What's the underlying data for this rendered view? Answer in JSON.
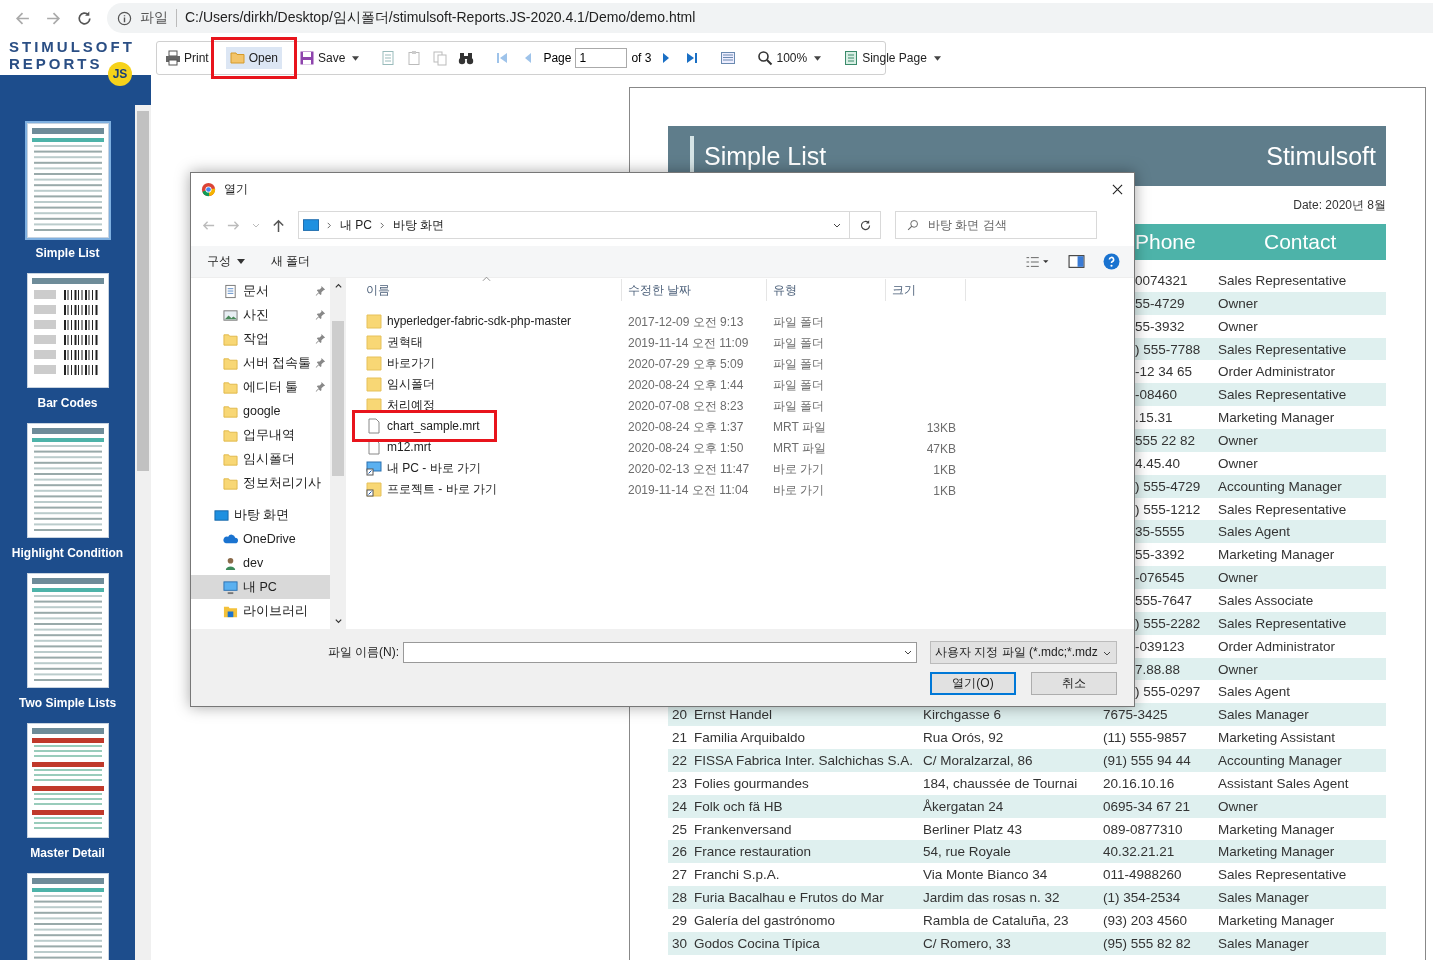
{
  "browser": {
    "scheme_label": "파일",
    "url": "C:/Users/dirkh/Desktop/임시폴더/stimulsoft-Reports.JS-2020.4.1/Demo/demo.html"
  },
  "logo": {
    "line1": "STIMULSOFT",
    "line2": "REPORTS",
    "badge": "JS"
  },
  "sidebar": {
    "items": [
      {
        "label": "Simple List",
        "kind": "list",
        "selected": true
      },
      {
        "label": "Bar Codes",
        "kind": "barcode",
        "selected": false
      },
      {
        "label": "Highlight Condition",
        "kind": "list",
        "selected": false
      },
      {
        "label": "Two Simple Lists",
        "kind": "list",
        "selected": false
      },
      {
        "label": "Master Detail",
        "kind": "master",
        "selected": false
      },
      {
        "kind": "list",
        "selected": false
      }
    ]
  },
  "toolbar": {
    "print": {
      "label": "Print"
    },
    "open": {
      "label": "Open",
      "highlighted": true,
      "annotated": true
    },
    "save": {
      "label": "Save"
    },
    "page_label": "Page",
    "page_input": "1",
    "page_count": "of 3",
    "zoom": "100%",
    "view_mode": "Single Page"
  },
  "report": {
    "title": "Simple List",
    "company": "Stimulsoft",
    "date": "Date: 2020년 8월",
    "columns": [
      "Phone",
      "Contact"
    ],
    "rows": [
      {
        "phone": "0074321",
        "contact": "Sales Representative"
      },
      {
        "phone": "55-4729",
        "contact": "Owner"
      },
      {
        "phone": "55-3932",
        "contact": "Owner"
      },
      {
        "phone": ") 555-7788",
        "contact": "Sales Representative"
      },
      {
        "phone": "-12 34 65",
        "contact": "Order Administrator"
      },
      {
        "phone": "-08460",
        "contact": "Sales Representative"
      },
      {
        "phone": ".15.31",
        "contact": "Marketing Manager"
      },
      {
        "phone": "555 22 82",
        "contact": "Owner"
      },
      {
        "phone": "4.45.40",
        "contact": "Owner"
      },
      {
        "phone": ") 555-4729",
        "contact": "Accounting Manager"
      },
      {
        "phone": ") 555-1212",
        "contact": "Sales Representative"
      },
      {
        "phone": "35-5555",
        "contact": "Sales Agent"
      },
      {
        "phone": "55-3392",
        "contact": "Marketing Manager"
      },
      {
        "phone": "-076545",
        "contact": "Owner"
      },
      {
        "phone": "555-7647",
        "contact": "Sales Associate"
      },
      {
        "phone": ") 555-2282",
        "contact": "Sales Representative"
      },
      {
        "phone": "-039123",
        "contact": "Order Administrator"
      },
      {
        "phone": "7.88.88",
        "contact": "Owner"
      },
      {
        "phone": ") 555-0297",
        "contact": "Sales Agent"
      },
      {
        "number": "20",
        "company": "Ernst Handel",
        "address": "Kirchgasse 6",
        "phone": "7675-3425",
        "contact": "Sales Manager"
      },
      {
        "number": "21",
        "company": "Familia Arquibaldo",
        "address": "Rua Orós, 92",
        "phone": "(11) 555-9857",
        "contact": "Marketing Assistant"
      },
      {
        "number": "22",
        "company": "FISSA Fabrica Inter. Salchichas S.A.",
        "address": "C/ Moralzarzal, 86",
        "phone": "(91) 555 94 44",
        "contact": "Accounting Manager"
      },
      {
        "number": "23",
        "company": "Folies gourmandes",
        "address": "184, chaussée de Tournai",
        "phone": "20.16.10.16",
        "contact": "Assistant Sales Agent"
      },
      {
        "number": "24",
        "company": "Folk och fä HB",
        "address": "Åkergatan 24",
        "phone": "0695-34 67 21",
        "contact": "Owner"
      },
      {
        "number": "25",
        "company": "Frankenversand",
        "address": "Berliner Platz 43",
        "phone": "089-0877310",
        "contact": "Marketing Manager"
      },
      {
        "number": "26",
        "company": "France restauration",
        "address": "54, rue Royale",
        "phone": "40.32.21.21",
        "contact": "Marketing Manager"
      },
      {
        "number": "27",
        "company": "Franchi S.p.A.",
        "address": "Via Monte Bianco 34",
        "phone": "011-4988260",
        "contact": "Sales Representative"
      },
      {
        "number": "28",
        "company": "Furia Bacalhau e Frutos do Mar",
        "address": "Jardim das rosas n. 32",
        "phone": "(1) 354-2534",
        "contact": "Sales Manager"
      },
      {
        "number": "29",
        "company": "Galería del gastrónomo",
        "address": "Rambla de Cataluña, 23",
        "phone": "(93) 203 4560",
        "contact": "Marketing Manager"
      },
      {
        "number": "30",
        "company": "Godos Cocina Típica",
        "address": "C/ Romero, 33",
        "phone": "(95) 555 82 82",
        "contact": "Sales Manager"
      }
    ]
  },
  "dialog": {
    "title": "열기",
    "path": [
      "내 PC",
      "바탕 화면"
    ],
    "search_placeholder": "바탕 화면 검색",
    "organize": "구성",
    "new_folder": "새 폴더",
    "nav": {
      "quick_access": [
        {
          "label": "문서",
          "kind": "document",
          "pinned": true,
          "selected": false
        },
        {
          "label": "사진",
          "kind": "picture",
          "pinned": true,
          "selected": false
        },
        {
          "label": "작업",
          "kind": "folder",
          "pinned": true,
          "selected": false
        },
        {
          "label": "서버 접속툴",
          "kind": "folder",
          "pinned": true,
          "selected": false
        },
        {
          "label": "에디터 툴",
          "kind": "folder",
          "pinned": true,
          "selected": false
        },
        {
          "label": "google",
          "kind": "folder",
          "pinned": false,
          "selected": false
        },
        {
          "label": "업무내역",
          "kind": "folder",
          "pinned": false,
          "selected": false
        },
        {
          "label": "임시폴더",
          "kind": "folder",
          "pinned": false,
          "selected": false
        },
        {
          "label": "정보처리기사",
          "kind": "folder",
          "pinned": false,
          "selected": false
        }
      ],
      "tree": [
        {
          "label": "바탕 화면",
          "kind": "desktop",
          "selected": false,
          "children": [
            {
              "label": "OneDrive",
              "kind": "cloud",
              "selected": false
            },
            {
              "label": "dev",
              "kind": "user",
              "selected": false
            },
            {
              "label": "내 PC",
              "kind": "pc",
              "selected": true
            },
            {
              "label": "라이브러리",
              "kind": "library",
              "selected": false
            }
          ]
        }
      ]
    },
    "columns": [
      "이름",
      "수정한 날짜",
      "유형",
      "크기"
    ],
    "files": [
      {
        "name": "hyperledger-fabric-sdk-php-master",
        "kind": "folder",
        "modified": "2017-12-09 오전 9:13",
        "type": "파일 폴더",
        "selected": false,
        "annotated": false
      },
      {
        "name": "권혁태",
        "kind": "folder",
        "modified": "2019-11-14 오전 11:09",
        "type": "파일 폴더",
        "selected": false,
        "annotated": false
      },
      {
        "name": "바로가기",
        "kind": "folder",
        "modified": "2020-07-29 오후 5:09",
        "type": "파일 폴더",
        "selected": false,
        "annotated": false
      },
      {
        "name": "임시폴더",
        "kind": "folder",
        "modified": "2020-08-24 오후 1:44",
        "type": "파일 폴더",
        "selected": false,
        "annotated": false
      },
      {
        "name": "처리예정",
        "kind": "folder",
        "modified": "2020-07-08 오전 8:23",
        "type": "파일 폴더",
        "selected": false,
        "annotated": false
      },
      {
        "name": "chart_sample.mrt",
        "kind": "file",
        "modified": "2020-08-24 오후 1:37",
        "type": "MRT 파일",
        "size": "13KB",
        "selected": false,
        "annotated": true
      },
      {
        "name": "m12.mrt",
        "kind": "file",
        "modified": "2020-08-24 오후 1:50",
        "type": "MRT 파일",
        "size": "47KB",
        "selected": false,
        "annotated": false
      },
      {
        "name": "내 PC - 바로 가기",
        "kind": "pc_shortcut",
        "modified": "2020-02-13 오전 11:47",
        "type": "바로 가기",
        "size": "1KB",
        "selected": false,
        "annotated": false
      },
      {
        "name": "프로젝트 - 바로 가기",
        "kind": "folder_shortcut",
        "modified": "2019-11-14 오전 11:04",
        "type": "바로 가기",
        "size": "1KB",
        "selected": false,
        "annotated": false
      }
    ],
    "file_name_label": "파일 이름(N):",
    "filter": "사용자 지정 파일 (*.mdc;*.mdz",
    "buttons": [
      {
        "label": "열기(O)",
        "default": true
      },
      {
        "label": "취소",
        "default": false
      }
    ]
  }
}
